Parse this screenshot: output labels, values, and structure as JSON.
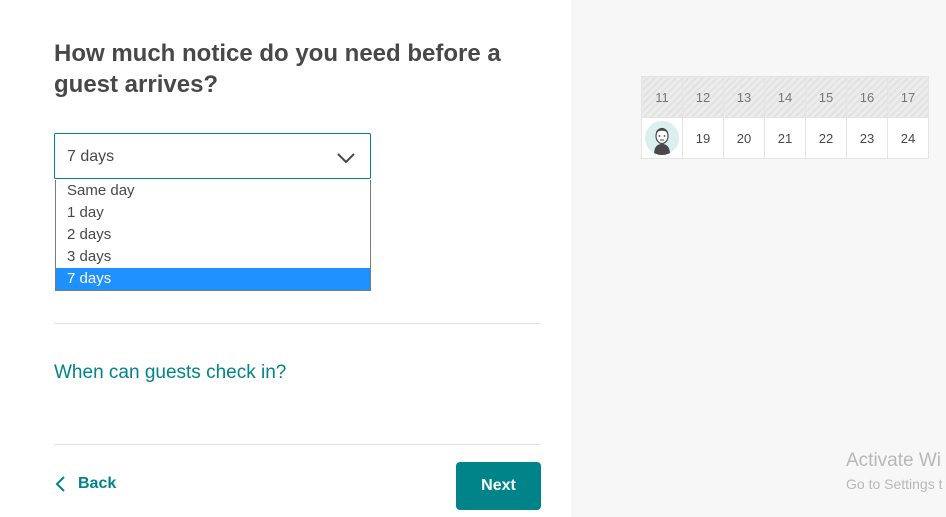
{
  "question": {
    "title": "How much notice do you need before a guest arrives?"
  },
  "notice_select": {
    "value": "7 days",
    "options": [
      "Same day",
      "1 day",
      "2 days",
      "3 days",
      "7 days"
    ],
    "selected_index": 4
  },
  "checkin": {
    "link_text": "When can guests check in?"
  },
  "nav": {
    "back_label": "Back",
    "next_label": "Next"
  },
  "calendar": {
    "row1": [
      "11",
      "12",
      "13",
      "14",
      "15",
      "16",
      "17"
    ],
    "row2": [
      "19",
      "20",
      "21",
      "22",
      "23",
      "24"
    ]
  },
  "watermark": {
    "title": "Activate Wi",
    "subtitle": "Go to Settings t"
  },
  "colors": {
    "accent": "#008489",
    "selected_option": "#1e90ff",
    "text": "#484848"
  }
}
